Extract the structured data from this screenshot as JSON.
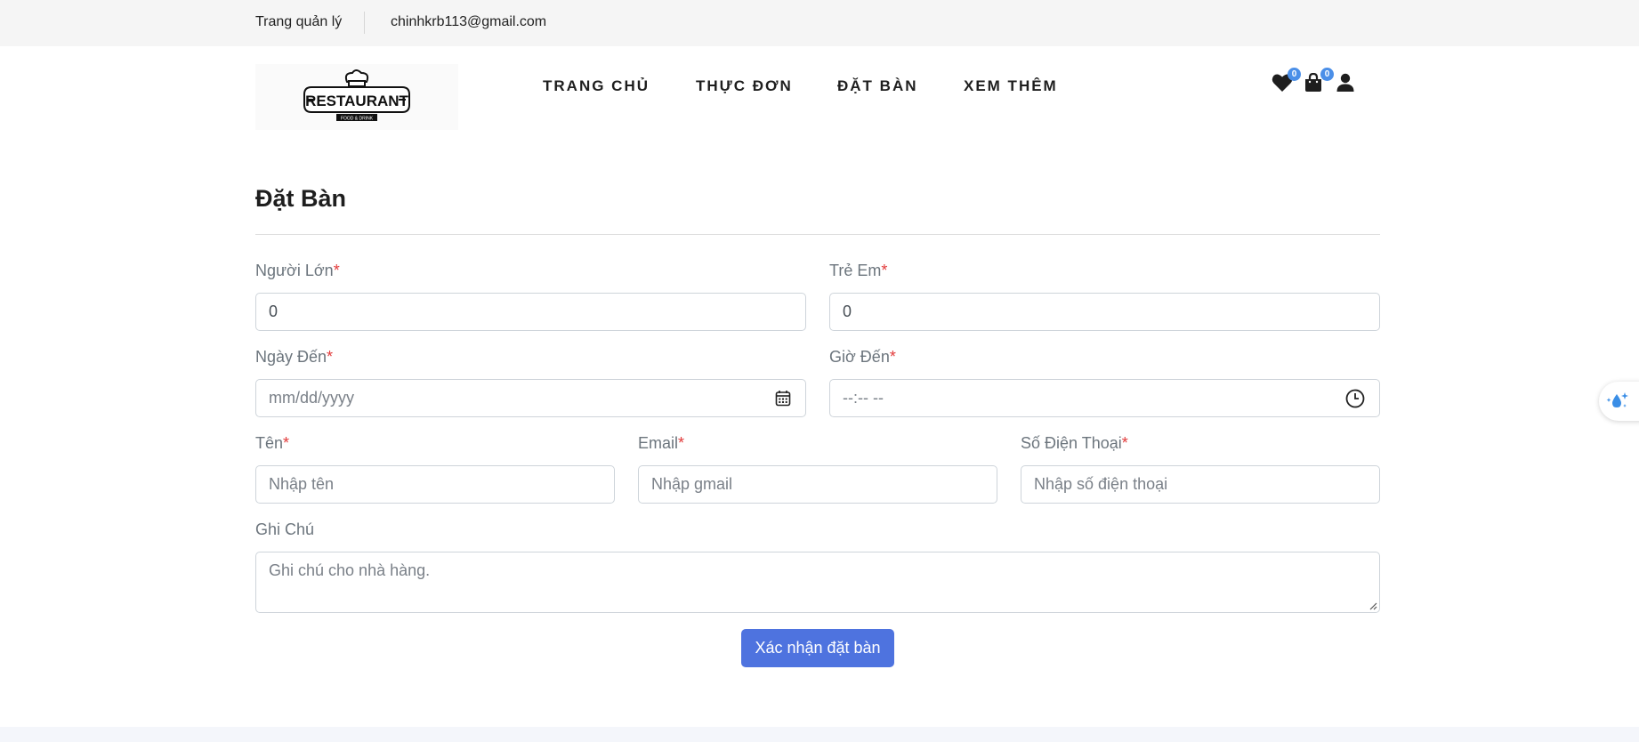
{
  "topbar": {
    "admin_link": "Trang quản lý",
    "email": "chinhkrb113@gmail.com"
  },
  "header": {
    "logo_text": "RESTAURANT",
    "logo_subtext": "FOOD & DRINK",
    "nav": [
      {
        "label": "TRANG CHỦ"
      },
      {
        "label": "THỰC ĐƠN"
      },
      {
        "label": "ĐẶT BÀN"
      },
      {
        "label": "XEM THÊM"
      }
    ],
    "wishlist_count": "0",
    "cart_count": "0",
    "icons": [
      "heart-icon",
      "shopping-bag-icon",
      "user-icon"
    ]
  },
  "form": {
    "title": "Đặt Bàn",
    "required_mark": "*",
    "adults": {
      "label": "Người Lớn",
      "value": "0"
    },
    "children": {
      "label": "Trẻ Em",
      "value": "0"
    },
    "date": {
      "label": "Ngày Đến",
      "placeholder": "mm/dd/yyyy"
    },
    "time": {
      "label": "Giờ Đến",
      "placeholder": "--:-- --"
    },
    "name": {
      "label": "Tên",
      "placeholder": "Nhập tên"
    },
    "email": {
      "label": "Email",
      "placeholder": "Nhập gmail"
    },
    "phone": {
      "label": "Số Điện Thoại",
      "placeholder": "Nhập số điện thoại"
    },
    "note": {
      "label": "Ghi Chú",
      "placeholder": "Ghi chú cho nhà hàng."
    },
    "submit_label": "Xác nhận đặt bàn"
  },
  "colors": {
    "primary_button": "#4e73df",
    "badge": "#4b8fe8",
    "required": "#e23b3b",
    "topbar_bg": "#f5f5f5"
  }
}
